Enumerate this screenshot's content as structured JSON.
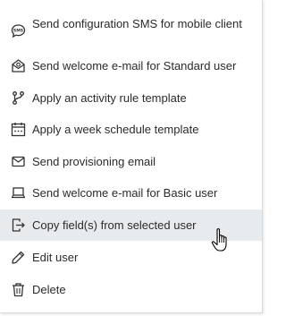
{
  "menu": {
    "items": [
      {
        "id": "sms",
        "label": "Send configuration SMS for mobile client",
        "icon": "sms-bubble-icon"
      },
      {
        "id": "welcome-standard",
        "label": "Send welcome e-mail for Standard user",
        "icon": "open-envelope-icon"
      },
      {
        "id": "activity-rule",
        "label": "Apply an activity rule template",
        "icon": "branch-icon"
      },
      {
        "id": "week-schedule",
        "label": "Apply a week schedule template",
        "icon": "calendar-icon"
      },
      {
        "id": "provisioning",
        "label": "Send provisioning email",
        "icon": "envelope-icon"
      },
      {
        "id": "welcome-basic",
        "label": "Send welcome e-mail for Basic user",
        "icon": "laptop-icon"
      },
      {
        "id": "copy-fields",
        "label": "Copy field(s) from selected user",
        "icon": "file-export-icon"
      },
      {
        "id": "edit-user",
        "label": "Edit user",
        "icon": "pencil-icon"
      },
      {
        "id": "delete",
        "label": "Delete",
        "icon": "trash-icon"
      }
    ],
    "hovered_item": "copy-fields"
  },
  "colors": {
    "text": "#2b2b2b",
    "icon": "#333333",
    "hover_background": "#e8ebee",
    "border": "#d9dbde"
  }
}
